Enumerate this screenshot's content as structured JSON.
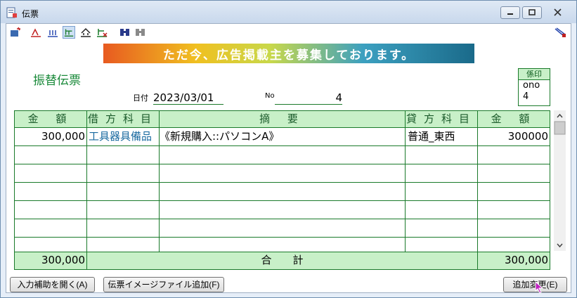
{
  "window": {
    "title": "伝票"
  },
  "banner": {
    "text": "ただ今、広告掲載主を募集しております。"
  },
  "form": {
    "title": "振替伝票",
    "seal_label": "係印",
    "seal_user_line1": "ono",
    "seal_user_line2": "4",
    "date_label": "日付",
    "date_value": "2023/03/01",
    "no_label": "No",
    "no_value": "4"
  },
  "table": {
    "headers": {
      "amount_debit": "金 額",
      "debit_account": "借方科目",
      "description": "摘 要",
      "credit_account": "貸方科目",
      "amount_credit": "金 額"
    },
    "rows": [
      {
        "amount_debit": "300,000",
        "debit_account": "工具器具備品",
        "description": "《新規購入::パソコンA》",
        "credit_account": "普通_東西",
        "amount_credit": "300000"
      }
    ],
    "empty_rows": 6,
    "total_label": "合　　計",
    "total_debit": "300,000",
    "total_credit": "300,000"
  },
  "buttons": {
    "input_help": "入力補助を開く(A)",
    "add_image": "伝票イメージファイル追加(F)",
    "add_change": "追加変更(E)"
  },
  "colors": {
    "header_bg": "#c8f0c8",
    "grid_line": "#1a7a2a",
    "account_text": "#1a6aa0"
  }
}
